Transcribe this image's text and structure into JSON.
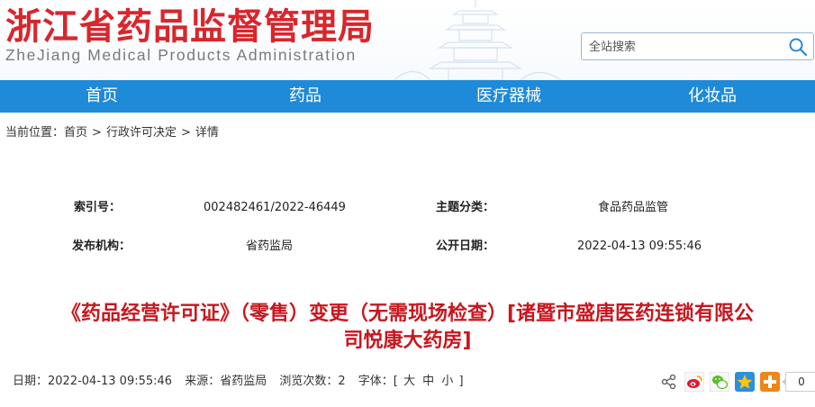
{
  "header": {
    "logo_cn": "浙江省药品监督管理局",
    "logo_en": "ZheJiang Medical Products Administration"
  },
  "search": {
    "placeholder": "全站搜索"
  },
  "nav": [
    {
      "label": "首页"
    },
    {
      "label": "药品"
    },
    {
      "label": "医疗器械"
    },
    {
      "label": "化妆品"
    }
  ],
  "breadcrumb": {
    "prefix": "当前位置：",
    "items": [
      "首页",
      "行政许可决定",
      "详情"
    ],
    "separator": ">"
  },
  "meta": {
    "index_label": "索引号：",
    "index_value": "002482461/2022-46449",
    "topic_label": "主题分类：",
    "topic_value": "食品药品监管",
    "org_label": "发布机构：",
    "org_value": "省药监局",
    "date_label": "公开日期：",
    "date_value": "2022-04-13 09:55:46"
  },
  "article": {
    "title_line1": "《药品经营许可证》（零售）变更（无需现场检查）[诸暨市盛唐医药连锁有限公",
    "title_line2": "司悦康大药房]",
    "date": "日期：2022-04-13 09:55:46",
    "source": "来源：省药监局",
    "views": "浏览次数：2",
    "font_prefix": "字体：[",
    "font_large": "大",
    "font_medium": "中",
    "font_small": "小",
    "font_suffix": "]"
  },
  "share": {
    "count": "0",
    "icons": [
      "share-icon",
      "weibo-icon",
      "wechat-icon",
      "qzone-icon",
      "more-share-icon"
    ]
  }
}
